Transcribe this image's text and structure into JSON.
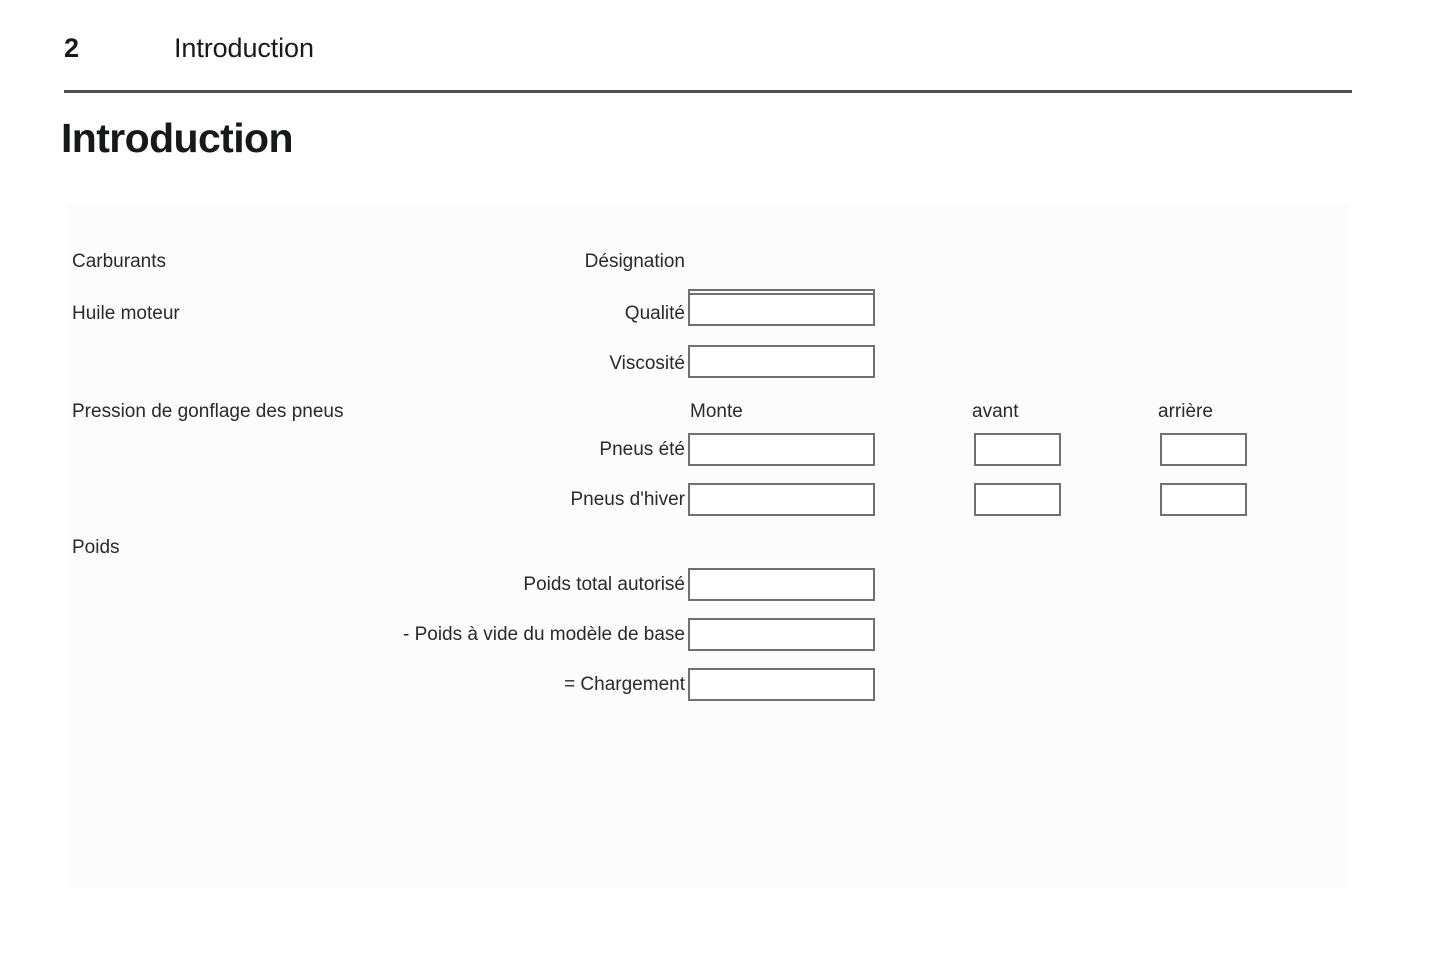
{
  "header": {
    "page_number": "2",
    "section_title": "Introduction"
  },
  "title": "Introduction",
  "form": {
    "columns": {
      "monte": "Monte",
      "front": "avant",
      "rear": "arrière"
    },
    "sections": [
      {
        "label": "Carburants"
      },
      {
        "label": "Huile moteur"
      },
      {
        "label": "Pression de gonflage des pneus"
      },
      {
        "label": "Poids"
      }
    ],
    "fields": {
      "designation": "Désignation",
      "qualite": "Qualité",
      "viscosite": "Viscosité",
      "pneus_ete": "Pneus été",
      "pneus_hiver": "Pneus d'hiver",
      "poids_total": "Poids total autorisé",
      "poids_vide": "- Poids à vide du modèle de base",
      "chargement": "= Chargement"
    },
    "values": {
      "designation": "",
      "qualite": "",
      "viscosite": "",
      "pneus_ete_monte": "",
      "pneus_ete_avant": "",
      "pneus_ete_arriere": "",
      "pneus_hiver_monte": "",
      "pneus_hiver_avant": "",
      "pneus_hiver_arriere": "",
      "poids_total": "",
      "poids_vide": "",
      "chargement": ""
    }
  },
  "colors": {
    "rule": "#4d4f52",
    "box_border": "#6e7073",
    "panel_bg": "#fcfcfc",
    "text": "#1a1a1a"
  }
}
